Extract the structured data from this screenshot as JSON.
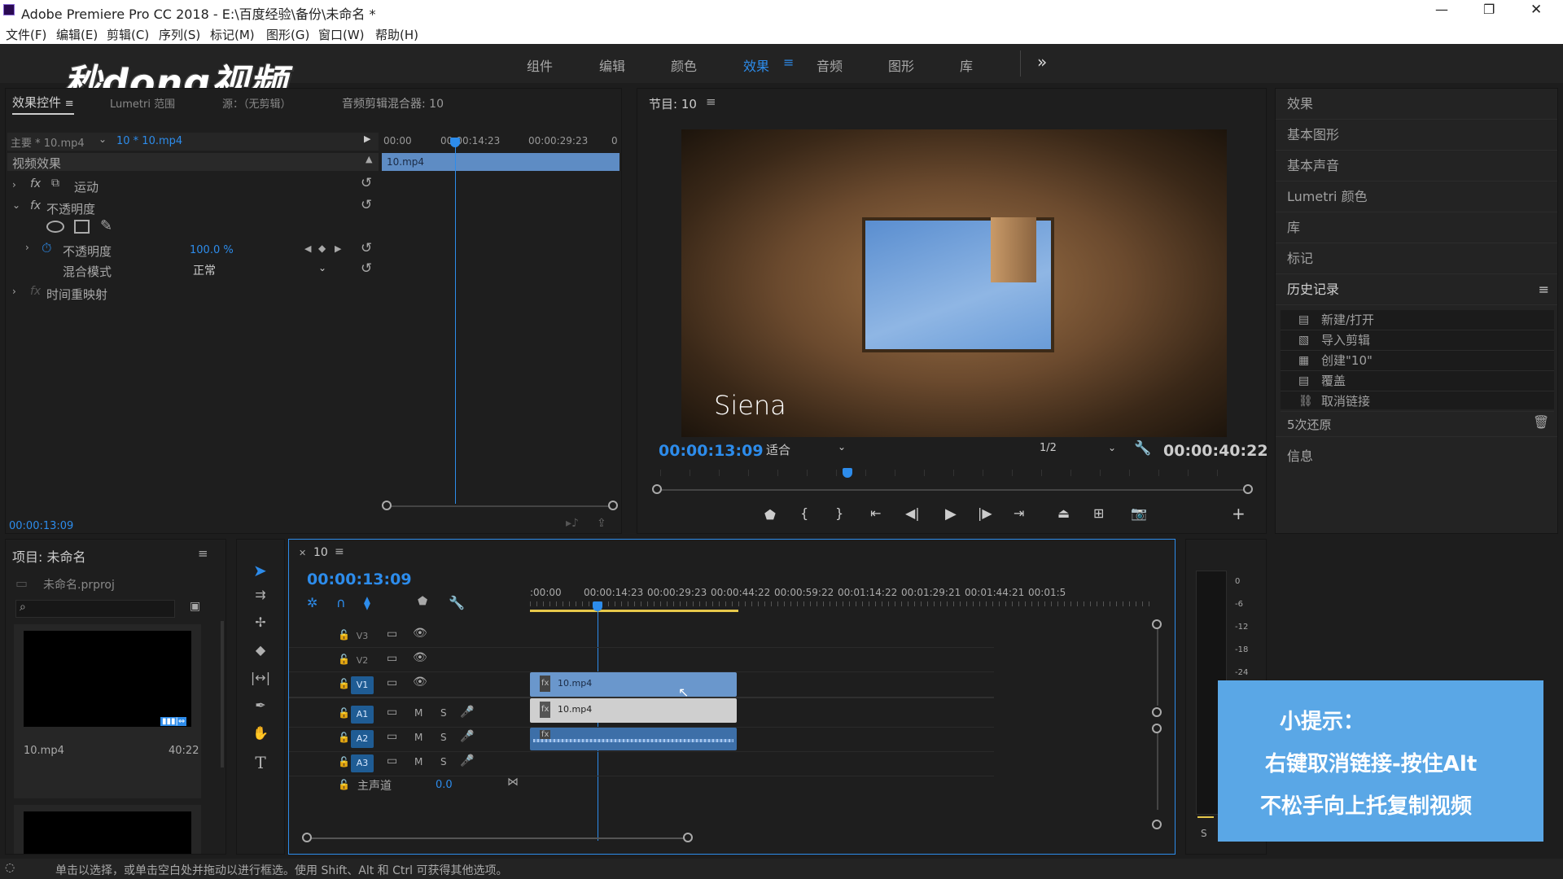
{
  "window": {
    "title": "Adobe Premiere Pro CC 2018 - E:\\百度经验\\备份\\未命名 *",
    "minimize": "—",
    "maximize": "❐",
    "close": "✕"
  },
  "menu": [
    "文件(F)",
    "编辑(E)",
    "剪辑(C)",
    "序列(S)",
    "标记(M)",
    "图形(G)",
    "窗口(W)",
    "帮助(H)"
  ],
  "workspaces": {
    "tabs": [
      "组件",
      "编辑",
      "颜色",
      "效果",
      "音频",
      "图形",
      "库"
    ],
    "active": "效果",
    "more": "»"
  },
  "watermark": "秒dong视频",
  "effect_controls": {
    "tabs": [
      "效果控件",
      "Lumetri 范围",
      "源：（无剪辑）",
      "音频剪辑混合器: 10"
    ],
    "source": "主要 * 10.mp4",
    "clip": "10 * 10.mp4",
    "ruler": [
      "00:00",
      "00:00:14:23",
      "00:00:29:23",
      "0"
    ],
    "clip_label": "10.mp4",
    "section": "视频效果",
    "motion": "运动",
    "opacity": "不透明度",
    "opacity_param": "不透明度",
    "opacity_value": "100.0 %",
    "blend_label": "混合模式",
    "blend_value": "正常",
    "time_remap": "时间重映射",
    "fx": "fx",
    "timecode": "00:00:13:09"
  },
  "program": {
    "title": "节目: 10",
    "caption": "Siena",
    "timecode": "00:00:13:09",
    "fit": "适合",
    "resolution": "1/2",
    "duration": "00:00:40:22"
  },
  "right_panel": {
    "items": [
      "效果",
      "基本图形",
      "基本声音",
      "Lumetri 颜色",
      "库",
      "标记"
    ],
    "history_title": "历史记录",
    "history": [
      "新建/打开",
      "导入剪辑",
      "创建\"10\"",
      "覆盖",
      "取消链接"
    ],
    "undo": "5次还原",
    "info": "信息"
  },
  "project": {
    "title": "项目: 未命名",
    "file": "未命名.prproj",
    "search_placeholder": "",
    "thumb_name": "10.mp4",
    "thumb_duration": "40:22"
  },
  "timeline": {
    "tab": "10",
    "timecode": "00:00:13:09",
    "ruler": [
      ":00:00",
      "00:00:14:23",
      "00:00:29:23",
      "00:00:44:22",
      "00:00:59:22",
      "00:01:14:22",
      "00:01:29:21",
      "00:01:44:21",
      "00:01:5"
    ],
    "video_tracks": [
      "V3",
      "V2",
      "V1"
    ],
    "audio_tracks": [
      "A1",
      "A2",
      "A3"
    ],
    "master": "主声道",
    "master_value": "0.0",
    "clip_v2": "10.mp4",
    "clip_v1": "10.mp4",
    "m": "M",
    "s": "S"
  },
  "meter": {
    "ticks": [
      "0",
      "-6",
      "-12",
      "-18",
      "-24"
    ],
    "s": "S"
  },
  "tip": {
    "title": "小提示：",
    "line1": "右键取消链接-按住Alt",
    "line2": "不松手向上托复制视频"
  },
  "status": "单击以选择，或单击空白处并拖动以进行框选。使用 Shift、Alt 和 Ctrl 可获得其他选项。",
  "colors": {
    "accent": "#2d8ceb",
    "tip_bg": "#5aa7e6",
    "clip_v2": "#6a97cc",
    "clip_v1": "#cfcfcf"
  }
}
